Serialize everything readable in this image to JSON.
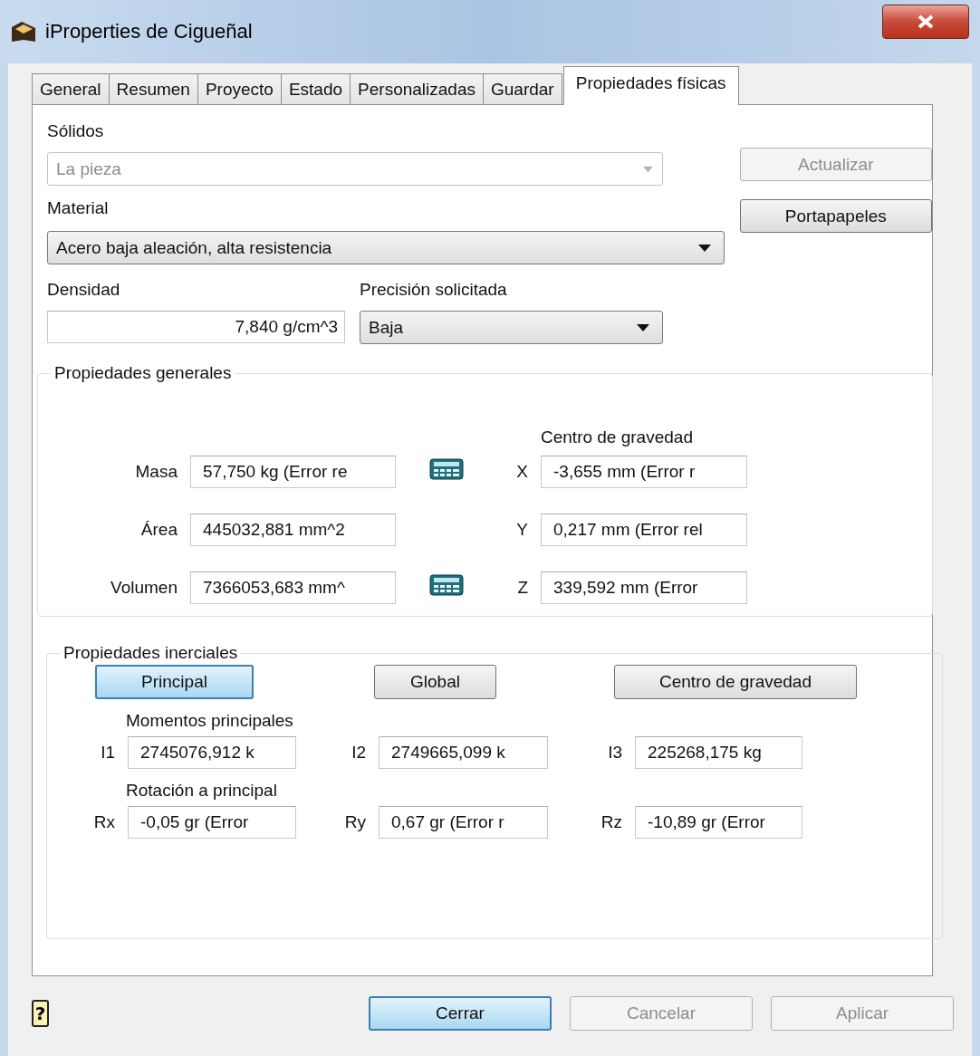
{
  "window": {
    "title": "iProperties de Cigueñal"
  },
  "tabs": [
    {
      "label": "General",
      "selected": false
    },
    {
      "label": "Resumen",
      "selected": false
    },
    {
      "label": "Proyecto",
      "selected": false
    },
    {
      "label": "Estado",
      "selected": false
    },
    {
      "label": "Personalizadas",
      "selected": false
    },
    {
      "label": "Guardar",
      "selected": false
    },
    {
      "label": "Propiedades físicas",
      "selected": true
    }
  ],
  "solids": {
    "label": "Sólidos",
    "value": "La pieza",
    "disabled": true
  },
  "side_buttons": [
    {
      "label": "Actualizar",
      "disabled": true
    },
    {
      "label": "Portapapeles",
      "disabled": false
    }
  ],
  "material": {
    "label": "Material",
    "value": "Acero baja aleación, alta resistencia",
    "disabled": false
  },
  "density": {
    "label": "Densidad",
    "value": "7,840 g/cm^3"
  },
  "precision": {
    "label": "Precisión solicitada",
    "value": "Baja",
    "disabled": false
  },
  "general_properties": {
    "title": "Propiedades generales",
    "center_label": "Centro de gravedad",
    "rows": [
      {
        "label": "Masa",
        "value": "57,750 kg (Error re",
        "calculator": true,
        "axis": "X",
        "axis_value": "-3,655 mm (Error r"
      },
      {
        "label": "Área",
        "value": "445032,881 mm^2",
        "calculator": false,
        "axis": "Y",
        "axis_value": "0,217 mm (Error rel"
      },
      {
        "label": "Volumen",
        "value": "7366053,683 mm^",
        "calculator": true,
        "axis": "Z",
        "axis_value": "339,592 mm (Error"
      }
    ]
  },
  "inertial_properties": {
    "title": "Propiedades inerciales",
    "buttons": [
      {
        "label": "Principal",
        "selected": true
      },
      {
        "label": "Global",
        "selected": false
      },
      {
        "label": "Centro de gravedad",
        "selected": false
      }
    ],
    "moments_label": "Momentos principales",
    "moments": [
      {
        "label": "I1",
        "value": "2745076,912 k"
      },
      {
        "label": "I2",
        "value": "2749665,099 k"
      },
      {
        "label": "I3",
        "value": "225268,175 kg"
      }
    ],
    "rotation_label": "Rotación a principal",
    "rotations": [
      {
        "label": "Rx",
        "value": "-0,05 gr (Error"
      },
      {
        "label": "Ry",
        "value": "0,67 gr (Error r"
      },
      {
        "label": "Rz",
        "value": "-10,89 gr (Error"
      }
    ]
  },
  "help_button": {
    "label": "?"
  },
  "footer_buttons": [
    {
      "label": "Cerrar",
      "focused": true,
      "disabled": false
    },
    {
      "label": "Cancelar",
      "focused": false,
      "disabled": true
    },
    {
      "label": "Aplicar",
      "focused": false,
      "disabled": true
    }
  ]
}
